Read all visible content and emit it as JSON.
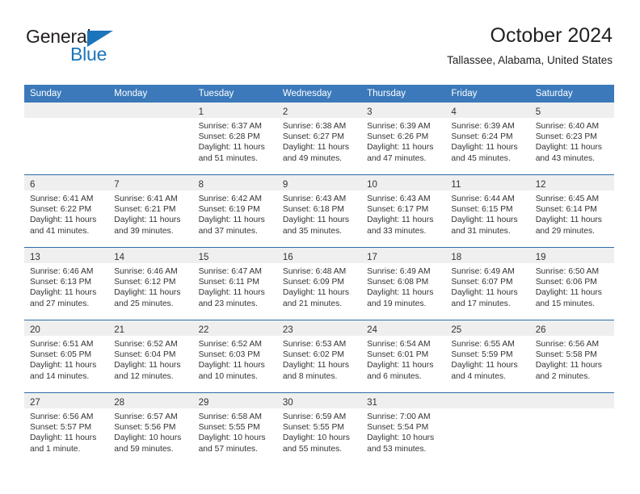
{
  "brand": {
    "name_part1": "General",
    "name_part2": "Blue",
    "logo_icon": "triangle-logo-icon"
  },
  "header": {
    "title": "October 2024",
    "location": "Tallassee, Alabama, United States"
  },
  "colors": {
    "header_blue": "#3b79ba",
    "rule_blue": "#2e6da8",
    "brand_blue": "#1b75bb",
    "daynum_band": "#efefef"
  },
  "calendar": {
    "weekday_headers": [
      "Sunday",
      "Monday",
      "Tuesday",
      "Wednesday",
      "Thursday",
      "Friday",
      "Saturday"
    ],
    "weeks": [
      [
        {
          "day": "",
          "lines": []
        },
        {
          "day": "",
          "lines": []
        },
        {
          "day": "1",
          "lines": [
            "Sunrise: 6:37 AM",
            "Sunset: 6:28 PM",
            "Daylight: 11 hours",
            "and 51 minutes."
          ]
        },
        {
          "day": "2",
          "lines": [
            "Sunrise: 6:38 AM",
            "Sunset: 6:27 PM",
            "Daylight: 11 hours",
            "and 49 minutes."
          ]
        },
        {
          "day": "3",
          "lines": [
            "Sunrise: 6:39 AM",
            "Sunset: 6:26 PM",
            "Daylight: 11 hours",
            "and 47 minutes."
          ]
        },
        {
          "day": "4",
          "lines": [
            "Sunrise: 6:39 AM",
            "Sunset: 6:24 PM",
            "Daylight: 11 hours",
            "and 45 minutes."
          ]
        },
        {
          "day": "5",
          "lines": [
            "Sunrise: 6:40 AM",
            "Sunset: 6:23 PM",
            "Daylight: 11 hours",
            "and 43 minutes."
          ]
        }
      ],
      [
        {
          "day": "6",
          "lines": [
            "Sunrise: 6:41 AM",
            "Sunset: 6:22 PM",
            "Daylight: 11 hours",
            "and 41 minutes."
          ]
        },
        {
          "day": "7",
          "lines": [
            "Sunrise: 6:41 AM",
            "Sunset: 6:21 PM",
            "Daylight: 11 hours",
            "and 39 minutes."
          ]
        },
        {
          "day": "8",
          "lines": [
            "Sunrise: 6:42 AM",
            "Sunset: 6:19 PM",
            "Daylight: 11 hours",
            "and 37 minutes."
          ]
        },
        {
          "day": "9",
          "lines": [
            "Sunrise: 6:43 AM",
            "Sunset: 6:18 PM",
            "Daylight: 11 hours",
            "and 35 minutes."
          ]
        },
        {
          "day": "10",
          "lines": [
            "Sunrise: 6:43 AM",
            "Sunset: 6:17 PM",
            "Daylight: 11 hours",
            "and 33 minutes."
          ]
        },
        {
          "day": "11",
          "lines": [
            "Sunrise: 6:44 AM",
            "Sunset: 6:15 PM",
            "Daylight: 11 hours",
            "and 31 minutes."
          ]
        },
        {
          "day": "12",
          "lines": [
            "Sunrise: 6:45 AM",
            "Sunset: 6:14 PM",
            "Daylight: 11 hours",
            "and 29 minutes."
          ]
        }
      ],
      [
        {
          "day": "13",
          "lines": [
            "Sunrise: 6:46 AM",
            "Sunset: 6:13 PM",
            "Daylight: 11 hours",
            "and 27 minutes."
          ]
        },
        {
          "day": "14",
          "lines": [
            "Sunrise: 6:46 AM",
            "Sunset: 6:12 PM",
            "Daylight: 11 hours",
            "and 25 minutes."
          ]
        },
        {
          "day": "15",
          "lines": [
            "Sunrise: 6:47 AM",
            "Sunset: 6:11 PM",
            "Daylight: 11 hours",
            "and 23 minutes."
          ]
        },
        {
          "day": "16",
          "lines": [
            "Sunrise: 6:48 AM",
            "Sunset: 6:09 PM",
            "Daylight: 11 hours",
            "and 21 minutes."
          ]
        },
        {
          "day": "17",
          "lines": [
            "Sunrise: 6:49 AM",
            "Sunset: 6:08 PM",
            "Daylight: 11 hours",
            "and 19 minutes."
          ]
        },
        {
          "day": "18",
          "lines": [
            "Sunrise: 6:49 AM",
            "Sunset: 6:07 PM",
            "Daylight: 11 hours",
            "and 17 minutes."
          ]
        },
        {
          "day": "19",
          "lines": [
            "Sunrise: 6:50 AM",
            "Sunset: 6:06 PM",
            "Daylight: 11 hours",
            "and 15 minutes."
          ]
        }
      ],
      [
        {
          "day": "20",
          "lines": [
            "Sunrise: 6:51 AM",
            "Sunset: 6:05 PM",
            "Daylight: 11 hours",
            "and 14 minutes."
          ]
        },
        {
          "day": "21",
          "lines": [
            "Sunrise: 6:52 AM",
            "Sunset: 6:04 PM",
            "Daylight: 11 hours",
            "and 12 minutes."
          ]
        },
        {
          "day": "22",
          "lines": [
            "Sunrise: 6:52 AM",
            "Sunset: 6:03 PM",
            "Daylight: 11 hours",
            "and 10 minutes."
          ]
        },
        {
          "day": "23",
          "lines": [
            "Sunrise: 6:53 AM",
            "Sunset: 6:02 PM",
            "Daylight: 11 hours",
            "and 8 minutes."
          ]
        },
        {
          "day": "24",
          "lines": [
            "Sunrise: 6:54 AM",
            "Sunset: 6:01 PM",
            "Daylight: 11 hours",
            "and 6 minutes."
          ]
        },
        {
          "day": "25",
          "lines": [
            "Sunrise: 6:55 AM",
            "Sunset: 5:59 PM",
            "Daylight: 11 hours",
            "and 4 minutes."
          ]
        },
        {
          "day": "26",
          "lines": [
            "Sunrise: 6:56 AM",
            "Sunset: 5:58 PM",
            "Daylight: 11 hours",
            "and 2 minutes."
          ]
        }
      ],
      [
        {
          "day": "27",
          "lines": [
            "Sunrise: 6:56 AM",
            "Sunset: 5:57 PM",
            "Daylight: 11 hours",
            "and 1 minute."
          ]
        },
        {
          "day": "28",
          "lines": [
            "Sunrise: 6:57 AM",
            "Sunset: 5:56 PM",
            "Daylight: 10 hours",
            "and 59 minutes."
          ]
        },
        {
          "day": "29",
          "lines": [
            "Sunrise: 6:58 AM",
            "Sunset: 5:55 PM",
            "Daylight: 10 hours",
            "and 57 minutes."
          ]
        },
        {
          "day": "30",
          "lines": [
            "Sunrise: 6:59 AM",
            "Sunset: 5:55 PM",
            "Daylight: 10 hours",
            "and 55 minutes."
          ]
        },
        {
          "day": "31",
          "lines": [
            "Sunrise: 7:00 AM",
            "Sunset: 5:54 PM",
            "Daylight: 10 hours",
            "and 53 minutes."
          ]
        },
        {
          "day": "",
          "lines": []
        },
        {
          "day": "",
          "lines": []
        }
      ]
    ]
  }
}
